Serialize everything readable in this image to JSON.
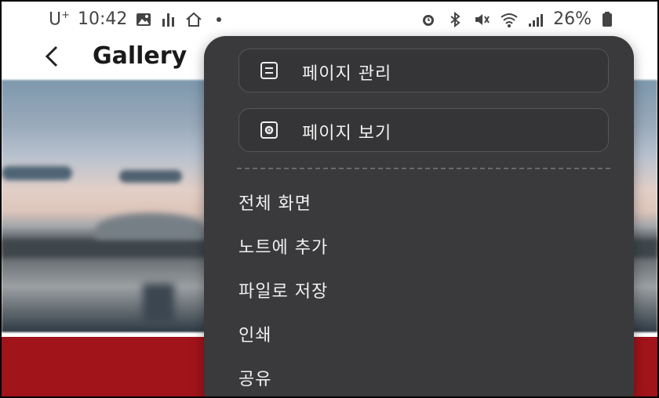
{
  "status_bar": {
    "carrier": "U",
    "carrier_sup": "+",
    "time": "10:42",
    "battery": "26%",
    "icons": [
      "image-icon",
      "bar-chart-icon",
      "home-icon",
      "dot-icon",
      "alarm-icon",
      "bluetooth-icon",
      "mute-icon",
      "wifi-icon",
      "signal-icon",
      "battery-icon"
    ]
  },
  "app_bar": {
    "back_icon": "back-arrow-icon",
    "title": "Gallery"
  },
  "menu": {
    "pills": [
      {
        "label": "페이지 관리",
        "icon": "list-icon"
      },
      {
        "label": "페이지 보기",
        "icon": "settings-icon"
      }
    ],
    "items": [
      {
        "label": "전체 화면"
      },
      {
        "label": "노트에 추가"
      },
      {
        "label": "파일로 저장"
      },
      {
        "label": "인쇄"
      },
      {
        "label": "공유"
      }
    ]
  },
  "colors": {
    "menu_bg": "#3a3a3c",
    "menu_text": "#f1f1f1",
    "red_band": "#a1141a"
  }
}
